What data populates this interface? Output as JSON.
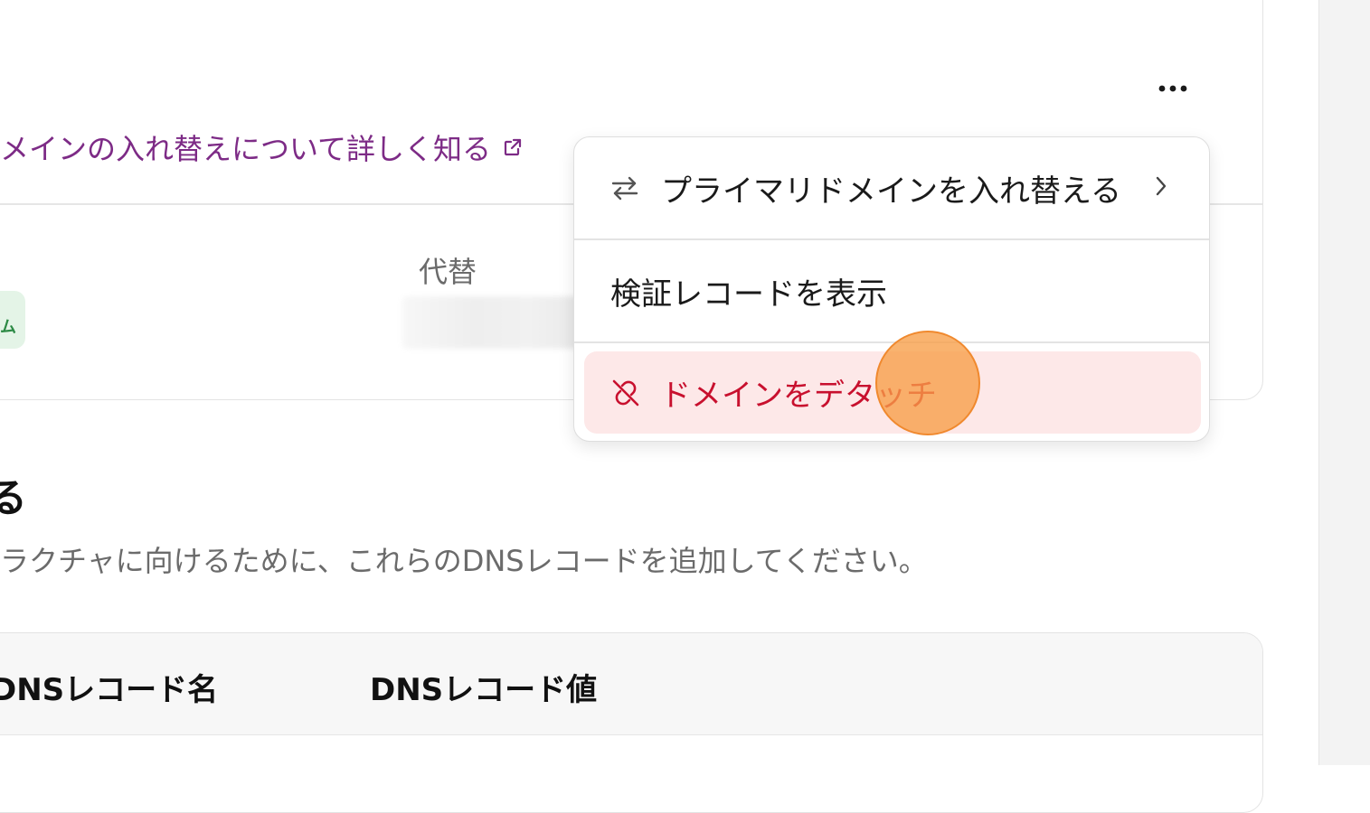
{
  "header": {
    "learn_link_label": "メインの入れ替えについて詳しく知る",
    "more_icon": "more-horizontal-icon",
    "external_icon": "external-link-icon"
  },
  "domains_table": {
    "column_alt_label": "代替",
    "status_badge_text": "ム"
  },
  "dns_section": {
    "heading": "る",
    "description": "ラクチャに向けるために、これらのDNSレコードを追加してください。",
    "columns": [
      "DNSレコード名",
      "DNSレコード値"
    ]
  },
  "menu": {
    "items": [
      {
        "label": "プライマリドメインを入れ替える",
        "icon": "swap-arrows-icon",
        "has_submenu": true
      },
      {
        "label": "検証レコードを表示"
      },
      {
        "label": "ドメインをデタッチ",
        "icon": "unlink-icon",
        "variant": "danger"
      }
    ]
  },
  "colors": {
    "link": "#7d2b86",
    "danger_text": "#c8102e",
    "danger_bg": "#fde8e8",
    "touch_indicator": "#f79e46"
  }
}
